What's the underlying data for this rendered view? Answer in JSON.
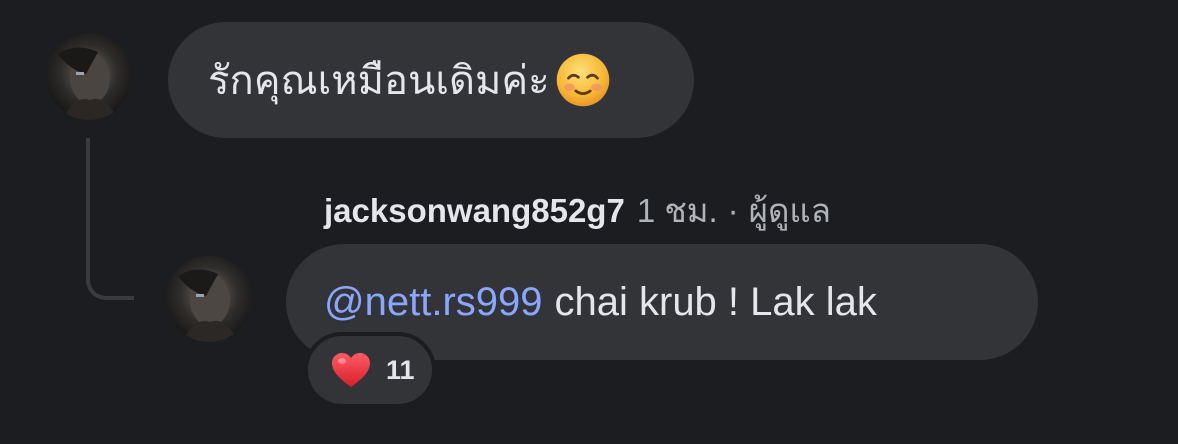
{
  "comments": [
    {
      "avatar_icon": "user-avatar-photo",
      "text": "รักคุณเหมือนเดิมค่ะ",
      "emoji_icon": "smiling-relieved-face-icon"
    }
  ],
  "reply": {
    "avatar_icon": "user-avatar-photo",
    "username": "jacksonwang852g7",
    "time": "1 ชม.",
    "separator": "·",
    "role": "ผู้ดูแล",
    "mention": "@nett.rs999",
    "text": "chai krub ! Lak lak",
    "reaction": {
      "icon": "heart-icon",
      "count": "11"
    }
  },
  "colors": {
    "background": "#1c1d20",
    "bubble": "#323438",
    "text": "#e4e6eb",
    "muted": "#b0b3b8",
    "mention": "#8aa7ff",
    "heart": "#e8303c"
  }
}
